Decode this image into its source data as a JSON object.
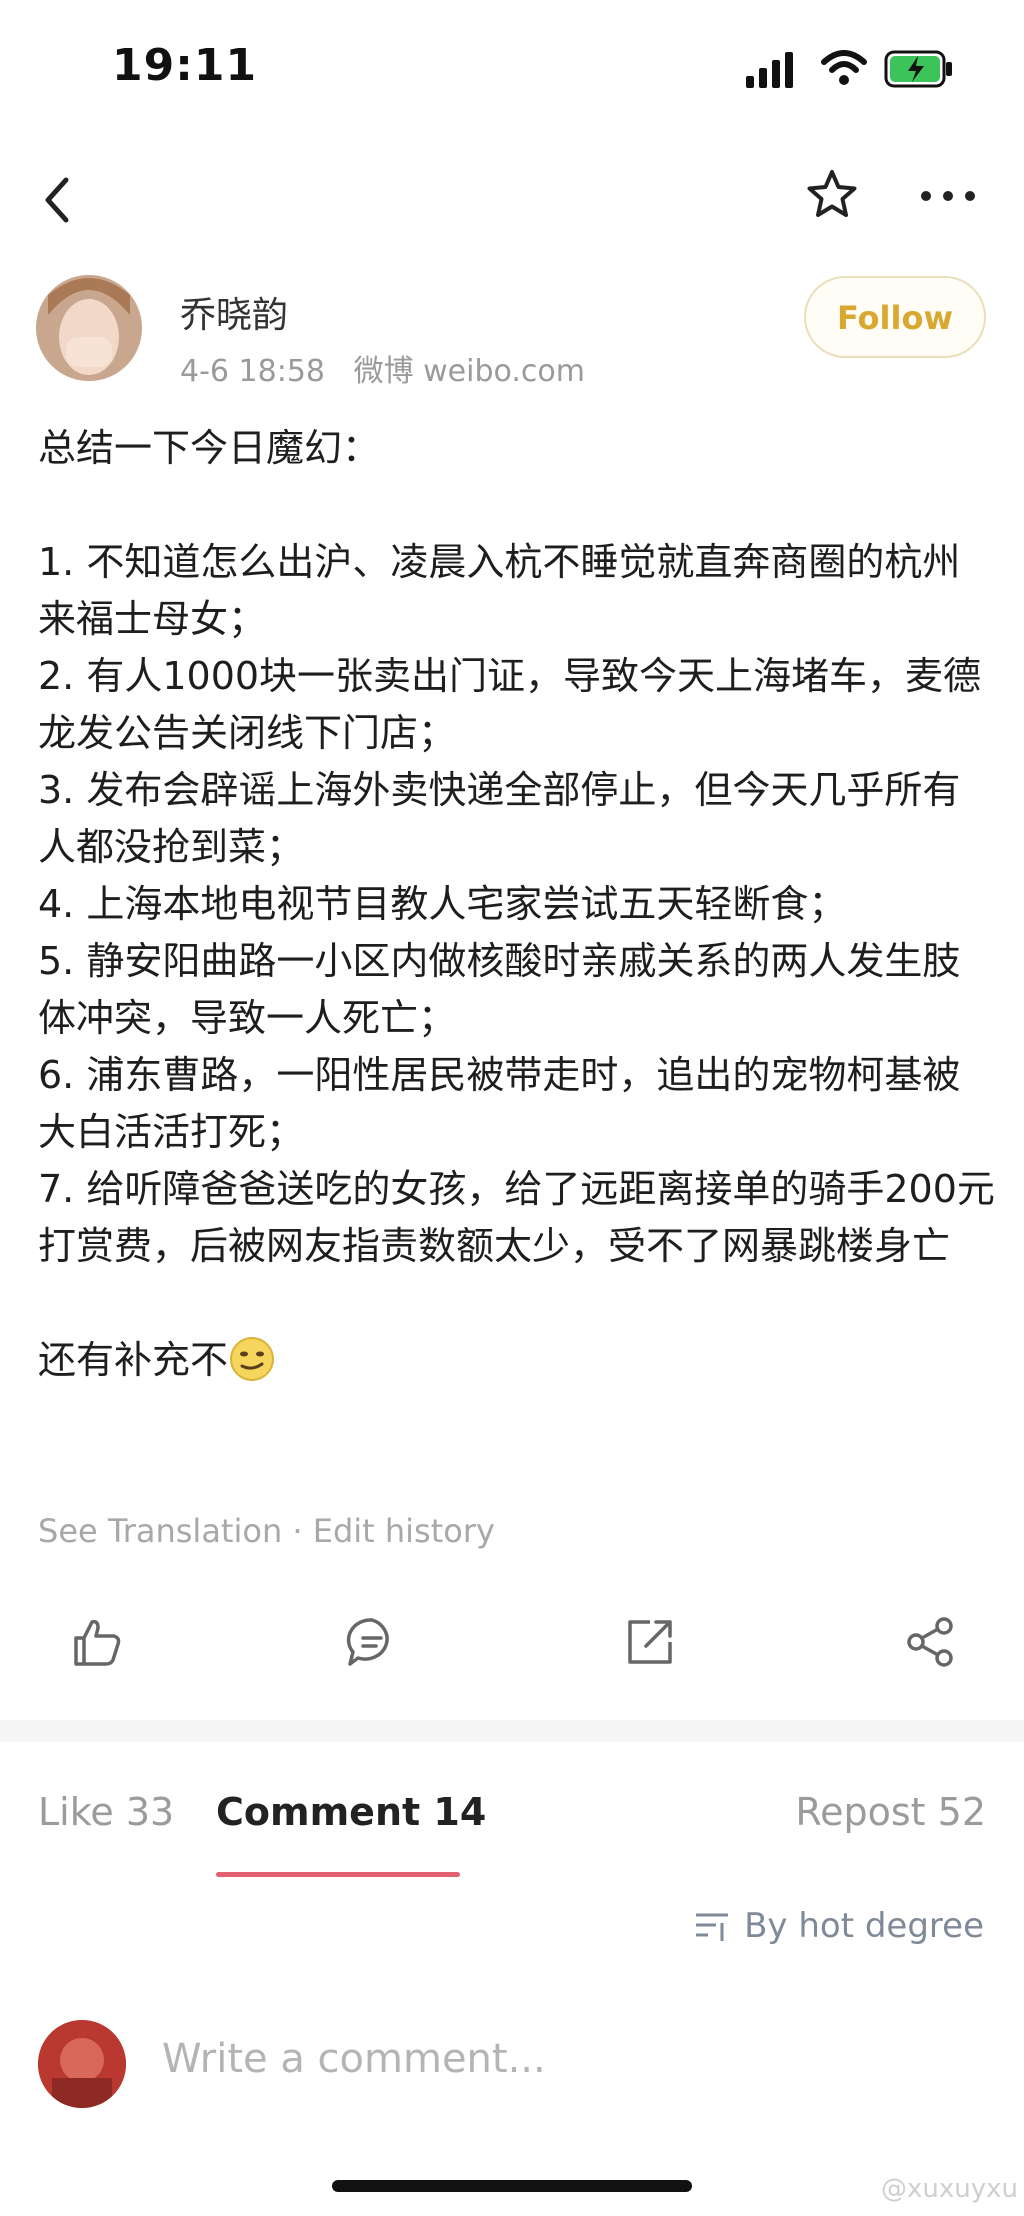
{
  "status_bar": {
    "time": "19:11"
  },
  "post": {
    "author": "乔晓韵",
    "date": "4-6 18:58",
    "source": "微博 weibo.com",
    "follow_label": "Follow",
    "lines": [
      "总结一下今日魔幻：",
      "",
      "1. 不知道怎么出沪、凌晨入杭不睡觉就直奔商圈的杭州来福士母女；",
      "2. 有人1000块一张卖出门证，导致今天上海堵车，麦德龙发公告关闭线下门店；",
      "3. 发布会辟谣上海外卖快递全部停止，但今天几乎所有人都没抢到菜；",
      "4. 上海本地电视节目教人宅家尝试五天轻断食；",
      "5. 静安阳曲路一小区内做核酸时亲戚关系的两人发生肢体冲突，导致一人死亡；",
      "6. 浦东曹路，一阳性居民被带走时，追出的宠物柯基被大白活活打死；",
      "7. 给听障爸爸送吃的女孩，给了远距离接单的骑手200元打赏费，后被网友指责数额太少，受不了网暴跳楼身亡",
      "",
      "还有补充不"
    ],
    "see_translation": "See Translation",
    "separator": "·",
    "edit_history": "Edit history"
  },
  "actions": [
    "like-icon",
    "comment-icon",
    "repost-icon",
    "share-icon"
  ],
  "tabs": {
    "like": "Like 33",
    "comment": "Comment 14",
    "repost": "Repost 52"
  },
  "sort_label": "By hot degree",
  "comment_placeholder": "Write a comment...",
  "watermark": "@xuxuyxu",
  "colors": {
    "accent": "#e2606f",
    "follow": "#d9a830",
    "muted": "#9b9b9b"
  }
}
